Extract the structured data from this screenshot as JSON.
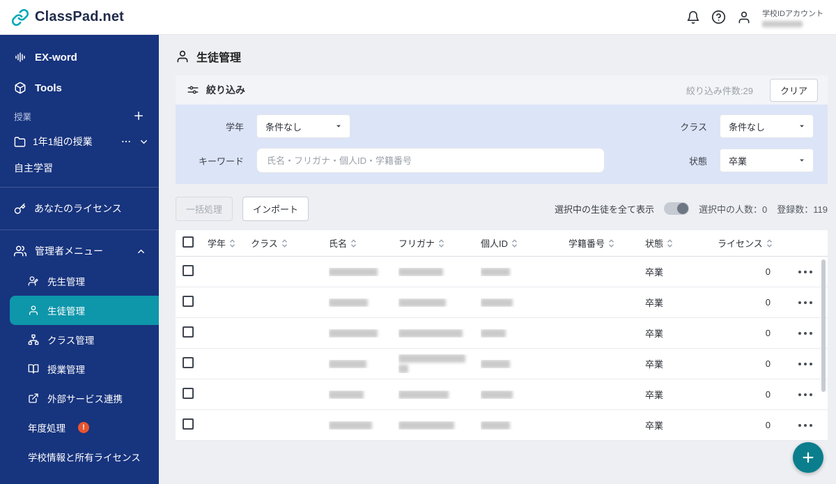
{
  "colors": {
    "sidebar_bg": "#17347E",
    "selected_teal": "#0E96AA",
    "fab_teal": "#0A7E8C",
    "logo_teal": "#00A8B6",
    "filter_panel_bg": "#DCE4F7",
    "alert_red": "#E8542F"
  },
  "topbar": {
    "logo_text": "ClassPad.net",
    "account_label": "学校IDアカウント"
  },
  "sidebar": {
    "exword_label": "EX-word",
    "tools_label": "Tools",
    "lesson_section_label": "授業",
    "lesson_item_label": "1年1組の授業",
    "self_study_label": "自主学習",
    "license_label": "あなたのライセンス",
    "admin_menu_label": "管理者メニュー",
    "admin_items": [
      {
        "label": "先生管理"
      },
      {
        "label": "生徒管理"
      },
      {
        "label": "クラス管理"
      },
      {
        "label": "授業管理"
      },
      {
        "label": "外部サービス連携"
      },
      {
        "label": "年度処理",
        "badge": "!"
      },
      {
        "label": "学校情報と所有ライセンス"
      }
    ]
  },
  "main": {
    "page_title": "生徒管理",
    "filter": {
      "title": "絞り込み",
      "result_count": "絞り込み件数:29",
      "clear_label": "クリア",
      "grade_label": "学年",
      "grade_value": "条件なし",
      "class_label": "クラス",
      "class_value": "条件なし",
      "keyword_label": "キーワード",
      "keyword_placeholder": "氏名・フリガナ・個人ID・学籍番号",
      "status_label": "状態",
      "status_value": "卒業"
    },
    "toolbar": {
      "bulk_label": "一括処理",
      "import_label": "インポート",
      "show_selected_label": "選択中の生徒を全て表示",
      "show_selected_on": false,
      "selected_count": "選択中の人数：0",
      "registered_count": "登録数：119"
    },
    "table": {
      "columns": [
        "学年",
        "クラス",
        "氏名",
        "フリガナ",
        "個人ID",
        "学籍番号",
        "状態",
        "ライセンス"
      ],
      "rows": [
        {
          "name_w": 70,
          "furi_w": 64,
          "id_w": 42,
          "status": "卒業",
          "license": "0"
        },
        {
          "name_w": 56,
          "furi_w": 68,
          "id_w": 46,
          "status": "卒業",
          "license": "0"
        },
        {
          "name_w": 70,
          "furi_w": 92,
          "id_w": 36,
          "status": "卒業",
          "license": "0"
        },
        {
          "name_w": 54,
          "furi_w": 96,
          "furi_w2": 14,
          "id_w": 42,
          "status": "卒業",
          "license": "0"
        },
        {
          "name_w": 50,
          "furi_w": 72,
          "id_w": 46,
          "status": "卒業",
          "license": "0"
        },
        {
          "name_w": 62,
          "furi_w": 80,
          "id_w": 42,
          "status": "卒業",
          "license": "0"
        }
      ]
    }
  }
}
